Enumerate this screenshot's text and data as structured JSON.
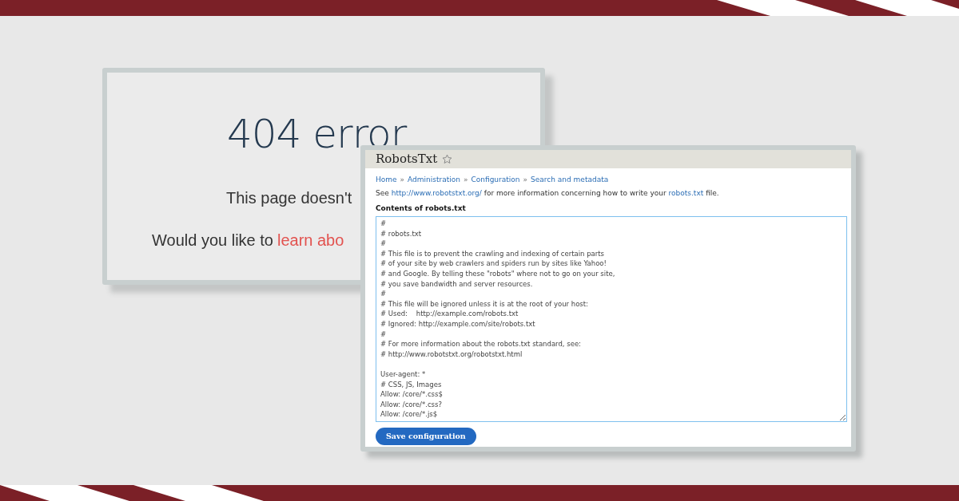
{
  "error_page": {
    "heading": "404 error",
    "message": "This page doesn't",
    "prompt": {
      "text": "Would you like to",
      "link": "learn abo"
    }
  },
  "robots_window": {
    "title": "RobotsTxt",
    "favorite": false,
    "breadcrumb": [
      {
        "kind": "link",
        "text": "Home"
      },
      {
        "kind": "separator",
        "text": "»"
      },
      {
        "kind": "link",
        "text": "Administration"
      },
      {
        "kind": "separator",
        "text": "»"
      },
      {
        "kind": "link",
        "text": "Configuration"
      },
      {
        "kind": "separator",
        "text": "»"
      },
      {
        "kind": "link",
        "text": "Search and metadata"
      }
    ],
    "help": [
      {
        "kind": "text",
        "text": "See"
      },
      {
        "kind": "link",
        "text": "http://www.robotstxt.org/"
      },
      {
        "kind": "text",
        "text": "for more information concerning how to write your"
      },
      {
        "kind": "link",
        "text": "robots.txt"
      },
      {
        "kind": "text",
        "text": "file."
      }
    ],
    "field_label": "Contents of robots.txt",
    "contents": "#\n# robots.txt\n#\n# This file is to prevent the crawling and indexing of certain parts\n# of your site by web crawlers and spiders run by sites like Yahoo!\n# and Google. By telling these \"robots\" where not to go on your site,\n# you save bandwidth and server resources.\n#\n# This file will be ignored unless it is at the root of your host:\n# Used:    http://example.com/robots.txt\n# Ignored: http://example.com/site/robots.txt\n#\n# For more information about the robots.txt standard, see:\n# http://www.robotstxt.org/robotstxt.html\n\nUser-agent: *\n# CSS, JS, Images\nAllow: /core/*.css$\nAllow: /core/*.css?\nAllow: /core/*.js$",
    "button": "Save configuration"
  }
}
